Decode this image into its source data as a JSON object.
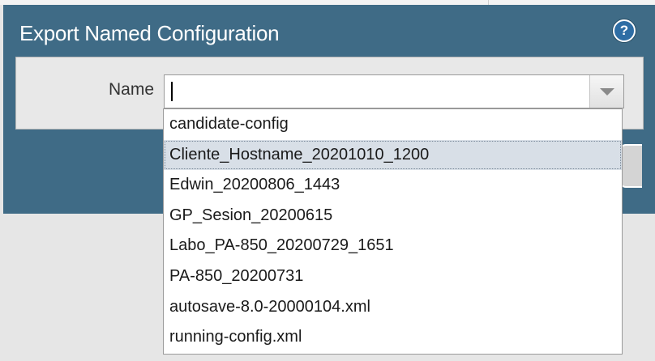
{
  "dialog": {
    "title": "Export Named Configuration",
    "help_icon": "?"
  },
  "form": {
    "name_label": "Name",
    "name_value": "",
    "combo_trigger_icon": "chevron-down-icon"
  },
  "dropdown": {
    "highlighted_index": 1,
    "items": [
      "candidate-config",
      "Cliente_Hostname_20201010_1200",
      "Edwin_20200806_1443",
      "GP_Sesion_20200615",
      "Labo_PA-850_20200729_1651",
      "PA-850_20200731",
      "autosave-8.0-20000104.xml",
      "running-config.xml"
    ]
  },
  "colors": {
    "header_bg": "#3f6b86",
    "highlight_bg": "#d8dfe7",
    "help_icon_bg": "#2e6da4"
  }
}
